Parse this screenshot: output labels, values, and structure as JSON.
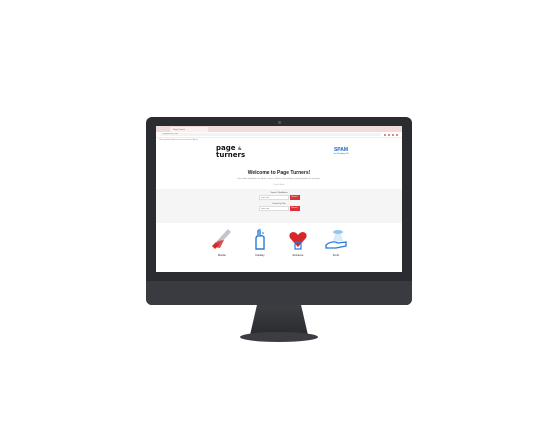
{
  "browser": {
    "tab_title": "Page Turners",
    "url": "pageturners.com",
    "bookmarks": "Library  Books  Authors  Genres  Events  About"
  },
  "header": {
    "logo_line1": "page",
    "logo_amp": "&",
    "logo_line2": "turners",
    "badge_big": "SPAM",
    "badge_small": "Get Reading Gift"
  },
  "welcome": {
    "title": "Welcome to Page Turners!",
    "intro": "Your online destination for books, stories, authors and reading recommendations for everyone.",
    "subnote": "Find a Book"
  },
  "search": {
    "group1_label": "Search Title/Author",
    "group1_placeholder": "Enter title",
    "group1_button": "Search",
    "group2_label": "Search by Title",
    "group2_placeholder": "Enter title",
    "group2_button": "Search"
  },
  "genres": [
    {
      "label": "Murder"
    },
    {
      "label": "Fantasy"
    },
    {
      "label": "Romance"
    },
    {
      "label": "Sci-Fi"
    }
  ]
}
